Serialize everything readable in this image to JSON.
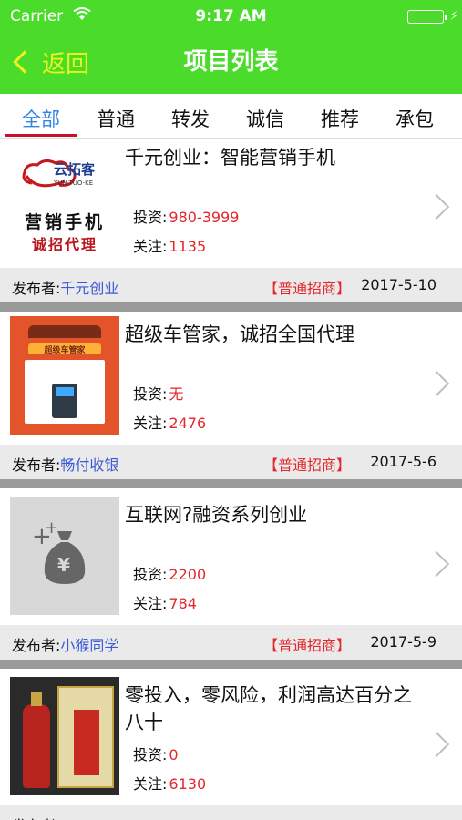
{
  "status_bar": {
    "carrier": "Carrier",
    "time": "9:17 AM"
  },
  "nav": {
    "back_label": "返回",
    "title": "项目列表"
  },
  "tabs": [
    {
      "label": "全部",
      "active": true
    },
    {
      "label": "普通",
      "active": false
    },
    {
      "label": "转发",
      "active": false
    },
    {
      "label": "诚信",
      "active": false
    },
    {
      "label": "推荐",
      "active": false
    },
    {
      "label": "承包",
      "active": false
    }
  ],
  "labels": {
    "invest": "投资:",
    "follow": "关注:",
    "publisher": "发布者:"
  },
  "colors": {
    "header_green": "#4bdc2b",
    "back_yellow": "#e8f51a",
    "active_tab_blue": "#2f86e6",
    "value_red": "#e5262a",
    "publisher_blue": "#3a5ad6"
  },
  "projects": [
    {
      "title": "千元创业：智能营销手机",
      "invest": "980-3999",
      "follow": "1135",
      "publisher": "千元创业",
      "tag": "【普通招商】",
      "date": "2017-5-10",
      "thumb": {
        "kind": "logo",
        "brand": "云拓客",
        "brand_en": "YUN-TUO-KE",
        "main": "营销手机",
        "sub": "诚招代理"
      }
    },
    {
      "title": "超级车管家，诚招全国代理",
      "invest": "无",
      "follow": "2476",
      "publisher": "畅付收银",
      "tag": "【普通招商】",
      "date": "2017-5-6",
      "thumb": {
        "kind": "poster",
        "caption": "超级车管家"
      }
    },
    {
      "title": "互联网?融资系列创业",
      "invest": "2200",
      "follow": "784",
      "publisher": "小猴同学",
      "tag": "【普通招商】",
      "date": "2017-5-9",
      "thumb": {
        "kind": "placeholder",
        "icon": "money-bag-icon"
      }
    },
    {
      "title": "零投入，零风险，利润高达百分之八十",
      "invest": "0",
      "follow": "6130",
      "publisher": "",
      "tag": "",
      "date": "",
      "thumb": {
        "kind": "product"
      }
    }
  ]
}
